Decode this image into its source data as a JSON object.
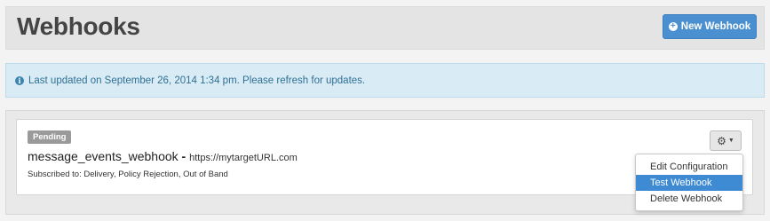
{
  "header": {
    "title": "Webhooks",
    "new_button_label": "New Webhook",
    "new_button_icon": "plus-circle-icon"
  },
  "alert": {
    "icon": "info-icon",
    "text": "Last updated on September 26, 2014 1:34 pm. Please refresh for updates."
  },
  "webhook": {
    "status": "Pending",
    "name": "message_events_webhook",
    "separator": " - ",
    "url": "https://mytargetURL.com",
    "subscribed": "Subscribed to: Delivery, Policy Rejection, Out of Band"
  },
  "actions_menu": {
    "button_icon": "gear-icon",
    "items": [
      {
        "label": "Edit Configuration",
        "active": false
      },
      {
        "label": "Test Webhook",
        "active": true
      },
      {
        "label": "Delete Webhook",
        "active": false
      }
    ]
  },
  "colors": {
    "primary": "#4a8fcf",
    "alert_bg": "#d9ecf6",
    "alert_text": "#2f6f93",
    "badge": "#9a9a9a",
    "menu_active": "#3e8ad3"
  }
}
